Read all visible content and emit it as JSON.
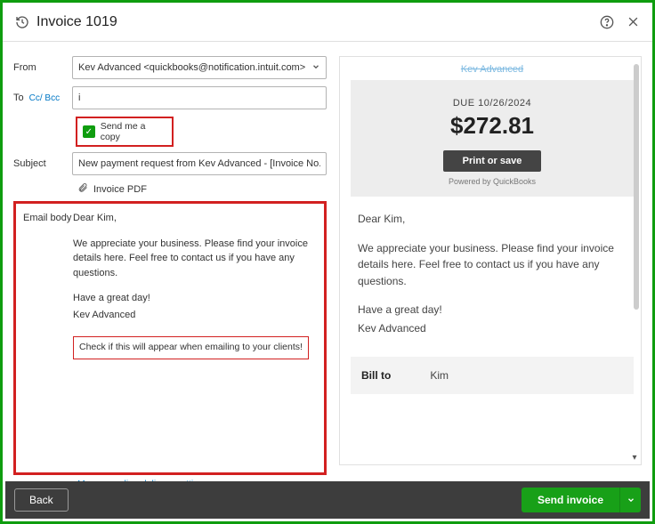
{
  "header": {
    "title": "Invoice 1019"
  },
  "form": {
    "from_label": "From",
    "from_value": "Kev Advanced <quickbooks@notification.intuit.com>",
    "to_label": "To",
    "ccbcc": "Cc/  Bcc",
    "to_value": "i",
    "send_me_copy": "Send me a copy",
    "subject_label": "Subject",
    "subject_value": "New payment request from Kev Advanced - [Invoice No.]",
    "attachment": "Invoice PDF",
    "body_label": "Email body",
    "body_greeting": "Dear Kim,",
    "body_p1": "We appreciate your business. Please find your invoice details here. Feel free to contact us if you have any questions.",
    "body_p2": "Have a great day!",
    "body_sign": "Kev Advanced",
    "body_check": "Check if this will appear when emailing to your clients!",
    "manage_link": "Manage online delivery settings"
  },
  "preview": {
    "top_link": "Kev Advanced",
    "due_label": "DUE 10/26/2024",
    "amount": "$272.81",
    "print_btn": "Print or save",
    "powered": "Powered by QuickBooks",
    "greeting": "Dear Kim,",
    "body": "We appreciate your business. Please find your invoice details here. Feel free to contact us if you have any questions.",
    "closing1": "Have a great day!",
    "closing2": "Kev Advanced",
    "bill_to_label": "Bill to",
    "bill_to_value": "Kim"
  },
  "footer": {
    "back": "Back",
    "send": "Send invoice"
  }
}
